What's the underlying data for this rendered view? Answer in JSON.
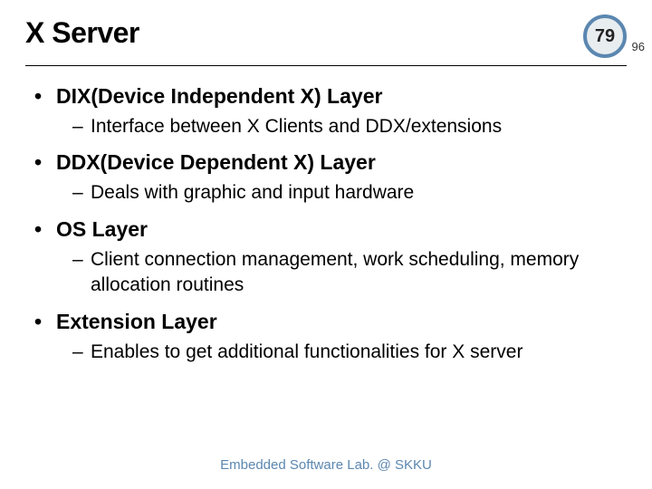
{
  "header": {
    "title": "X Server",
    "page_current": "79",
    "page_total": "96"
  },
  "bullets": [
    {
      "heading": "DIX(Device Independent X) Layer",
      "subs": [
        "Interface between X Clients and DDX/extensions"
      ]
    },
    {
      "heading": "DDX(Device Dependent X) Layer",
      "subs": [
        "Deals with graphic and input hardware"
      ]
    },
    {
      "heading": "OS Layer",
      "subs": [
        "Client connection management, work scheduling, memory allocation routines"
      ]
    },
    {
      "heading": "Extension Layer",
      "subs": [
        "Enables to get additional functionalities for X server"
      ]
    }
  ],
  "footer": {
    "text": "Embedded Software Lab. @ SKKU"
  }
}
